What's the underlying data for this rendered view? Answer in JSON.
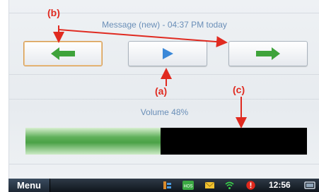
{
  "message": {
    "title": "Message (new) - 04:37 PM today"
  },
  "nav": {
    "previous_icon": "arrow-left-icon",
    "play_icon": "play-icon",
    "next_icon": "arrow-right-icon"
  },
  "volume": {
    "label": "Volume 48%",
    "level_percent": 48
  },
  "annotations": {
    "a": "(a)",
    "b": "(b)",
    "c": "(c)"
  },
  "taskbar": {
    "menu_label": "Menu",
    "clock": "12:56",
    "tray_icons": [
      "tasks-icon",
      "hos-icon",
      "mail-icon",
      "wifi-signal-icon",
      "alert-icon",
      "tablet-icon"
    ],
    "hos_label": "HOS"
  },
  "colors": {
    "accent_text": "#6a8fb8",
    "annotation_red": "#e02a20",
    "arrow_green": "#3fa33b",
    "play_blue": "#3b88d8"
  }
}
